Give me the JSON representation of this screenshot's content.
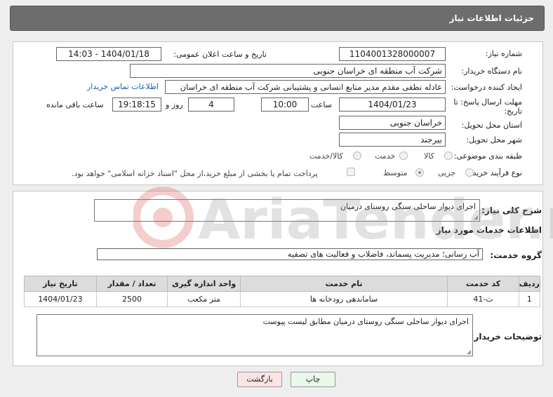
{
  "header": {
    "title": "جزئیات اطلاعات نیاز"
  },
  "form": {
    "need_number_label": "شماره نیاز:",
    "need_number": "1104001328000007",
    "announce_label": "تاریخ و ساعت اعلان عمومی:",
    "announce_value": "1404/01/18 - 14:03",
    "buyer_org_label": "نام دستگاه خریدار:",
    "buyer_org": "شرکت آب منطقه ای خراسان جنوبی",
    "creator_label": "ایجاد کننده درخواست:",
    "creator": "عادله نطفی مقدم مدیر منابع انسانی و پشتیبانی شرکت آب منطقه ای خراسان",
    "contact_link": "اطلاعات تماس خریدار",
    "deadline_label_1": "مهلت ارسال پاسخ: تا",
    "deadline_label_2": "تاریخ:",
    "deadline_date": "1404/01/23",
    "time_label": "ساعت",
    "deadline_time": "10:00",
    "days_value": "4",
    "days_label": "روز و",
    "remaining_time": "19:18:15",
    "remaining_label": "ساعت باقی مانده",
    "province_label": "استان محل تحویل:",
    "province": "خراسان جنوبی",
    "city_label": "شهر محل تحویل:",
    "city": "بیرجند",
    "category_label": "طبقه بندی موضوعی:",
    "category_options": [
      "کالا",
      "خدمت",
      "کالا/خدمت"
    ],
    "process_label": "نوع فرآیند خرید :",
    "process_options": [
      "جزیی",
      "متوسط"
    ],
    "payment_note": "پرداخت تمام یا بخشی از مبلغ خرید،از محل \"اسناد خزانه اسلامی\" خواهد بود."
  },
  "details": {
    "summary_label": "شرح کلی نیاز:",
    "summary": "اجرای دیوار ساحلی سنگی روستای درمیان",
    "services_title": "اطلاعات خدمات مورد نیاز",
    "service_group_label": "گروه خدمت:",
    "service_group": "آب رسانی؛ مدیریت پسماند، فاضلاب و فعالیت های تصفیه",
    "table": {
      "headers": [
        "ردیف",
        "کد خدمت",
        "نام خدمت",
        "واحد اندازه گیری",
        "تعداد / مقدار",
        "تاریخ نیاز"
      ],
      "rows": [
        [
          "1",
          "ث-41",
          "ساماندهی رودخانه ها",
          "متر مکعب",
          "2500",
          "1404/01/23"
        ]
      ]
    },
    "buyer_notes_label": "توضیحات خریدار:",
    "buyer_notes": "اجرای دیوار ساحلی سنگی روستای درمیان مطابق لیست پیوست"
  },
  "buttons": {
    "print": "چاپ",
    "back": "بازگشت"
  },
  "watermark_text": "AriaTender.neT",
  "colors": {
    "header": "#6d6d6d",
    "link": "#1a5fb4",
    "back_button": "#fce4e4",
    "print_button": "#eaf7ea",
    "watermark": "#d9534f"
  }
}
